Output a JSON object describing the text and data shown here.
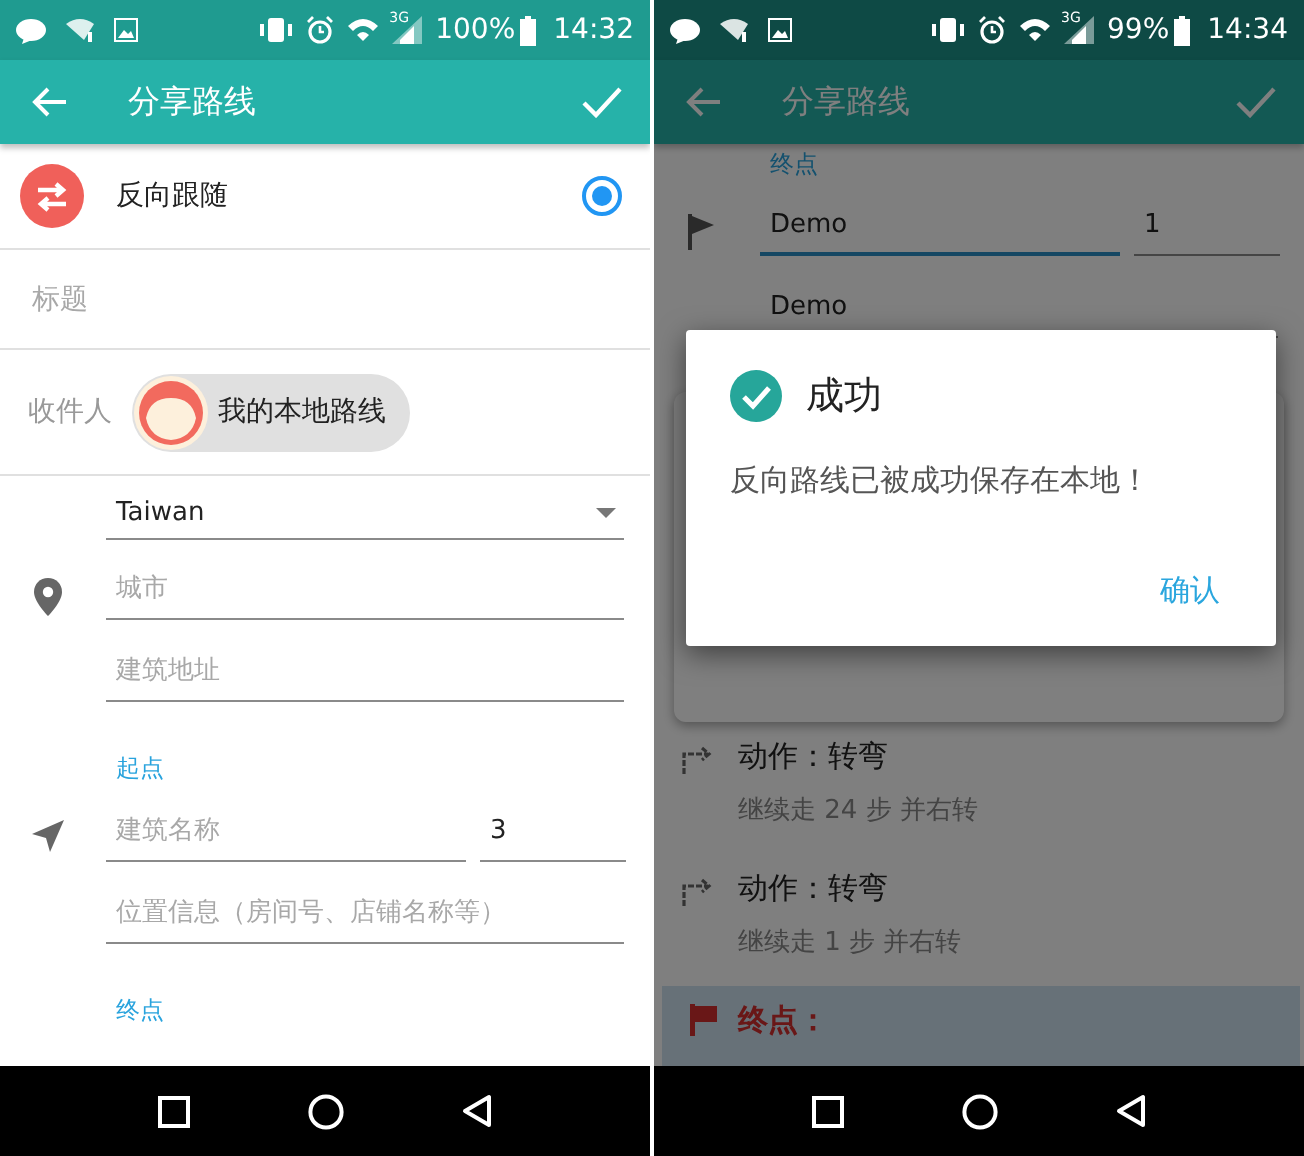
{
  "screens": [
    {
      "status_bar": {
        "network": "3G",
        "battery": "100%",
        "time": "14:32"
      },
      "app_bar": {
        "title": "分享路线"
      },
      "rows": [
        {
          "kind": "option",
          "label": "反向跟随",
          "selected": true
        },
        {
          "kind": "title_field",
          "placeholder": "标题"
        },
        {
          "kind": "recipient",
          "label": "收件人",
          "chip": "我的本地路线"
        },
        {
          "kind": "dropdown",
          "value": "Taiwan"
        },
        {
          "kind": "pin_field",
          "fields": [
            {
              "placeholder": "城市",
              "focused": false
            }
          ]
        },
        {
          "kind": "field",
          "fields": [
            {
              "placeholder": "建筑地址",
              "focused": false
            }
          ]
        },
        {
          "kind": "section_label",
          "text": "起点"
        },
        {
          "kind": "arrow_field",
          "fields": [
            {
              "placeholder": "建筑名称",
              "focused": false
            },
            {
              "value": "3",
              "focused": false
            }
          ]
        },
        {
          "kind": "field",
          "fields": [
            {
              "placeholder": "位置信息（房间号、店铺名称等）",
              "focused": false
            }
          ]
        },
        {
          "kind": "section_label",
          "text": "终点"
        }
      ]
    },
    {
      "status_bar": {
        "network": "3G",
        "battery": "99%",
        "time": "14:34"
      },
      "app_bar": {
        "title": "分享路线"
      },
      "rows": [
        {
          "kind": "section_label",
          "text": "终点"
        },
        {
          "kind": "flag_field",
          "fields": [
            {
              "value": "Demo",
              "focused": true
            },
            {
              "value": "1",
              "focused": false
            }
          ]
        },
        {
          "kind": "field",
          "fields": [
            {
              "value": "Demo",
              "focused": false
            }
          ]
        },
        {
          "kind": "card"
        },
        {
          "kind": "step",
          "title": "动作：转弯",
          "detail": "继续走 24 步 并右转"
        },
        {
          "kind": "step",
          "title": "动作：转弯",
          "detail": "继续走 1 步 并右转"
        },
        {
          "kind": "endpoint",
          "label": "终点："
        }
      ],
      "dialog": {
        "title": "成功",
        "message": "反向路线已被成功保存在本地！",
        "button": "确认"
      }
    }
  ]
}
